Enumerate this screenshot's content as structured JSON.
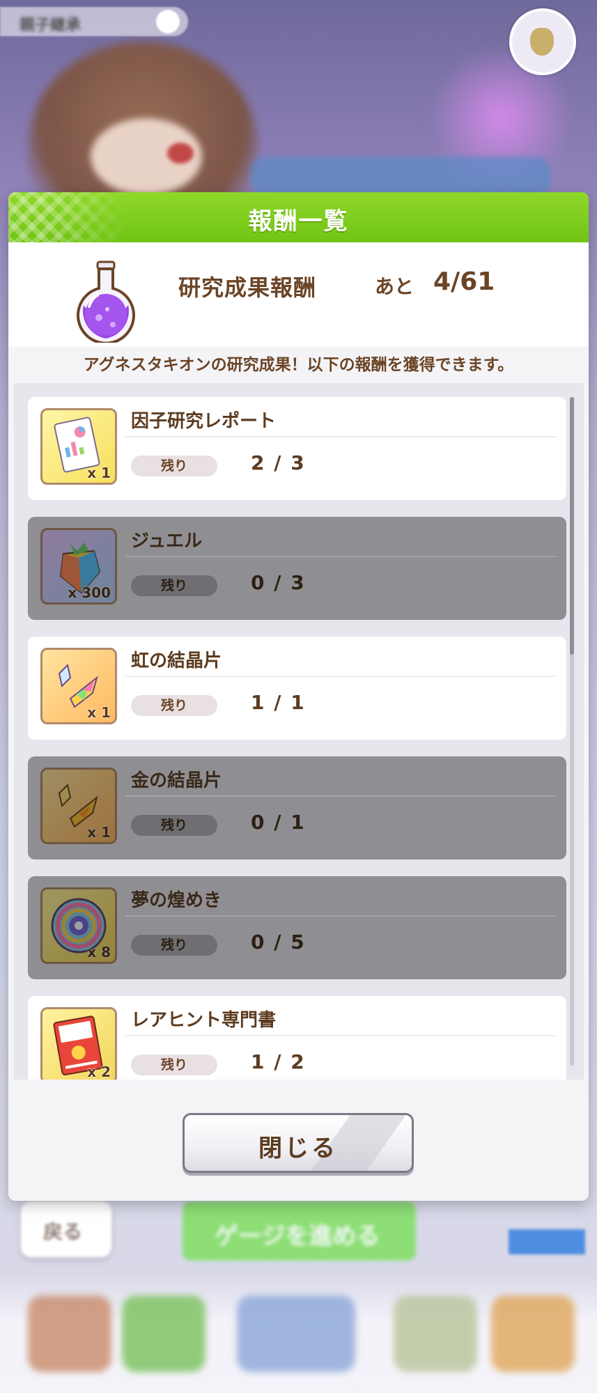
{
  "background": {
    "top_label": "親子継承",
    "left_button": "戻る",
    "center_button": "ゲージを進める"
  },
  "dialog": {
    "title": "報酬一覧",
    "summary": {
      "icon": "purple-flask-icon",
      "title": "研究成果報酬",
      "remaining_label": "あと",
      "remaining_value": "4/61"
    },
    "description": "アグネスタキオンの研究成果！以下の報酬を獲得できます。",
    "remaining_tag": "残り",
    "rewards": [
      {
        "name": "因子研究レポート",
        "quantity": "x 1",
        "remaining": "2 / 3",
        "icon": "research-report-icon",
        "completed": false
      },
      {
        "name": "ジュエル",
        "quantity": "x 300",
        "remaining": "0 / 3",
        "icon": "jewel-icon",
        "completed": true
      },
      {
        "name": "虹の結晶片",
        "quantity": "x 1",
        "remaining": "1 / 1",
        "icon": "rainbow-crystal-icon",
        "completed": false
      },
      {
        "name": "金の結晶片",
        "quantity": "x 1",
        "remaining": "0 / 1",
        "icon": "gold-crystal-icon",
        "completed": true
      },
      {
        "name": "夢の煌めき",
        "quantity": "x 8",
        "remaining": "0 / 5",
        "icon": "dream-sparkle-icon",
        "completed": true
      },
      {
        "name": "レアヒント専門書",
        "quantity": "x 2",
        "remaining": "1 / 2",
        "icon": "rare-hint-book-icon",
        "completed": false
      }
    ],
    "close_label": "閉じる"
  },
  "colors": {
    "header_green": "#7fcf1f",
    "text_brown": "#6b4426",
    "completed_row": "#8f8f93"
  }
}
